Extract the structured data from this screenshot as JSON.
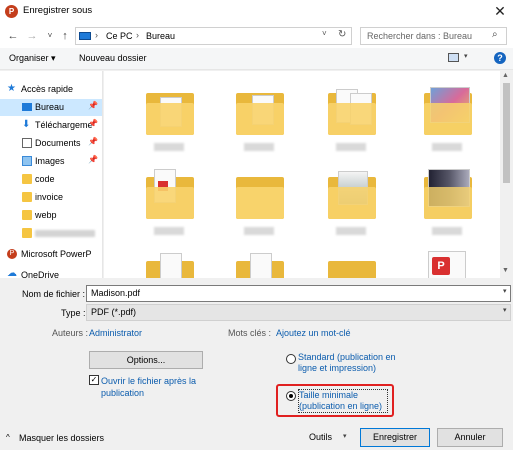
{
  "window": {
    "title": "Enregistrer sous",
    "close": "✕",
    "app_icon_letter": "P"
  },
  "nav_buttons": {
    "back": "←",
    "forward": "→",
    "recent": "˅",
    "up": "↑"
  },
  "address": {
    "separator": "›",
    "segments": [
      "Ce PC",
      "Bureau"
    ],
    "dropdown": "˅",
    "refresh": "↻"
  },
  "search": {
    "placeholder": "Rechercher dans : Bureau",
    "icon": "search-icon",
    "glyph": "⌕"
  },
  "toolbar": {
    "organise_label": "Organiser ▾",
    "new_folder_label": "Nouveau dossier",
    "view_dropdown": "▾",
    "help": "?"
  },
  "sidebar": {
    "items": [
      {
        "label": "Accès rapide",
        "icon": "star-icon",
        "glyph": "★",
        "color": "#1e7ad8"
      },
      {
        "label": "Bureau",
        "icon": "desktop-icon",
        "pin": "📌",
        "selected": true,
        "color": "#1e7ad8"
      },
      {
        "label": "Téléchargeme",
        "icon": "download-icon",
        "glyph": "⬇",
        "pin": "📌",
        "color": "#1e7ad8"
      },
      {
        "label": "Documents",
        "icon": "document-icon",
        "pin": "📌",
        "color": "#666666"
      },
      {
        "label": "Images",
        "icon": "image-icon",
        "pin": "📌",
        "color": "#3a8ad8"
      },
      {
        "label": "code",
        "icon": "folder-icon",
        "color": "#f5c542"
      },
      {
        "label": "invoice",
        "icon": "folder-icon",
        "color": "#f5c542"
      },
      {
        "label": "webp",
        "icon": "folder-icon",
        "color": "#f5c542"
      },
      {
        "label": "",
        "icon": "folder-icon",
        "color": "#f5c542"
      },
      {
        "label": "Microsoft PowerP",
        "icon": "powerpoint-icon",
        "glyph": "P",
        "color": "#c43e1c"
      },
      {
        "label": "OneDrive",
        "icon": "cloud-icon",
        "glyph": "☁",
        "color": "#1e7ad8"
      }
    ]
  },
  "content": {
    "pdf_badge_letter": "P"
  },
  "form": {
    "filename_label": "Nom de fichier :",
    "filename_value": "Madison.pdf",
    "type_label": "Type :",
    "type_value": "PDF (*.pdf)",
    "authors_label": "Auteurs :",
    "authors_value": "Administrator",
    "keywords_label": "Mots clés :",
    "keywords_value": "Ajoutez un mot-clé",
    "options_button": "Options...",
    "open_after_publish": "Ouvrir le fichier après la publication",
    "open_after_checked": true,
    "open_after_mark": "✓",
    "dropdown": "▾",
    "radio_standard": "Standard (publication en ligne et impression)",
    "radio_minimal": "Taille minimale (publication en ligne)",
    "selected_radio": "minimal"
  },
  "footer": {
    "hide_folders_icon": "^",
    "hide_folders": "Masquer les dossiers",
    "tools_label": "Outils",
    "tools_dropdown": "▾",
    "save_button": "Enregistrer",
    "cancel_button": "Annuler"
  },
  "colors": {
    "accent": "#0078d7",
    "highlight": "#e02020",
    "link": "#0b5cad",
    "folder": "#f8d36b"
  }
}
